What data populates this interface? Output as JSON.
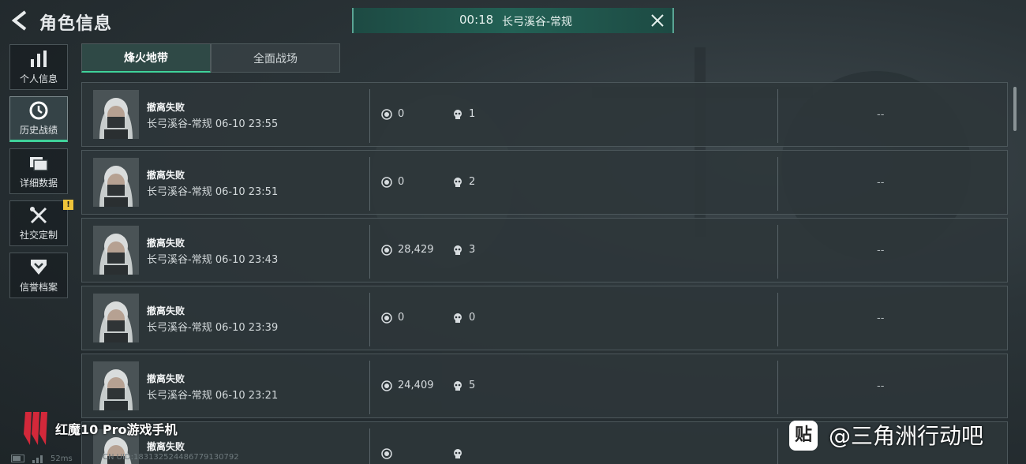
{
  "header": {
    "title": "角色信息",
    "banner": {
      "timer": "00:18",
      "map": "长弓溪谷-常规"
    }
  },
  "sidebar": {
    "items": [
      {
        "label": "个人信息",
        "icon": "bar-chart-icon"
      },
      {
        "label": "历史战绩",
        "icon": "history-clock-icon"
      },
      {
        "label": "详细数据",
        "icon": "folder-icon"
      },
      {
        "label": "社交定制",
        "icon": "tools-icon",
        "badge": "!"
      },
      {
        "label": "信誉档案",
        "icon": "shield-chevron-icon"
      }
    ]
  },
  "tabs": [
    "烽火地带",
    "全面战场"
  ],
  "matches": [
    {
      "result": "撤离失败",
      "map": "长弓溪谷-常规",
      "time": "06-10 23:55",
      "value": "0",
      "kills": "1",
      "extra": "--"
    },
    {
      "result": "撤离失败",
      "map": "长弓溪谷-常规",
      "time": "06-10 23:51",
      "value": "0",
      "kills": "2",
      "extra": "--"
    },
    {
      "result": "撤离失败",
      "map": "长弓溪谷-常规",
      "time": "06-10 23:43",
      "value": "28,429",
      "kills": "3",
      "extra": "--"
    },
    {
      "result": "撤离失败",
      "map": "长弓溪谷-常规",
      "time": "06-10 23:39",
      "value": "0",
      "kills": "0",
      "extra": "--"
    },
    {
      "result": "撤离失败",
      "map": "长弓溪谷-常规",
      "time": "06-10 23:21",
      "value": "24,409",
      "kills": "5",
      "extra": "--"
    },
    {
      "result": "撤离失败",
      "map": "",
      "time": "",
      "value": "",
      "kills": "",
      "extra": ""
    }
  ],
  "overlay": {
    "brand": "红魔10 Pro游戏手机",
    "tieba": "@三角洲行动吧",
    "tieba_logo": "贴",
    "ping": "52ms",
    "uid": "CN UID:18313252448677913079​2"
  },
  "colors": {
    "accent": "#3fd29a",
    "banner": "#236155",
    "badge": "#f0c43a"
  }
}
